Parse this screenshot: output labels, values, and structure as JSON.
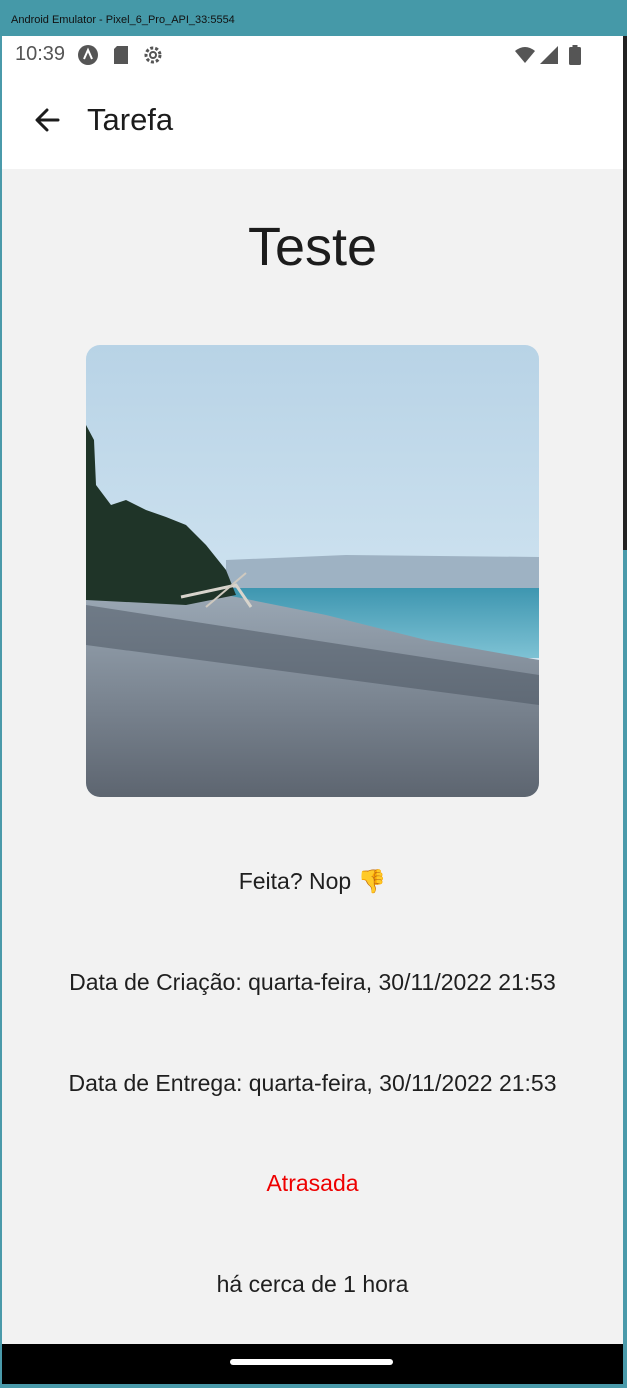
{
  "window": {
    "title": "Android Emulator - Pixel_6_Pro_API_33:5554"
  },
  "status_bar": {
    "time": "10:39"
  },
  "app_bar": {
    "title": "Tarefa"
  },
  "task": {
    "name": "Teste",
    "done_label": "Feita? Nop 👎",
    "created": "Data de Criação: quarta-feira, 30/11/2022 21:53",
    "due": "Data de Entrega: quarta-feira, 30/11/2022 21:53",
    "status": "Atrasada",
    "relative_time": "há cerca de 1 hora"
  },
  "colors": {
    "late": "#ee0000",
    "window_frame": "#4599a8"
  }
}
